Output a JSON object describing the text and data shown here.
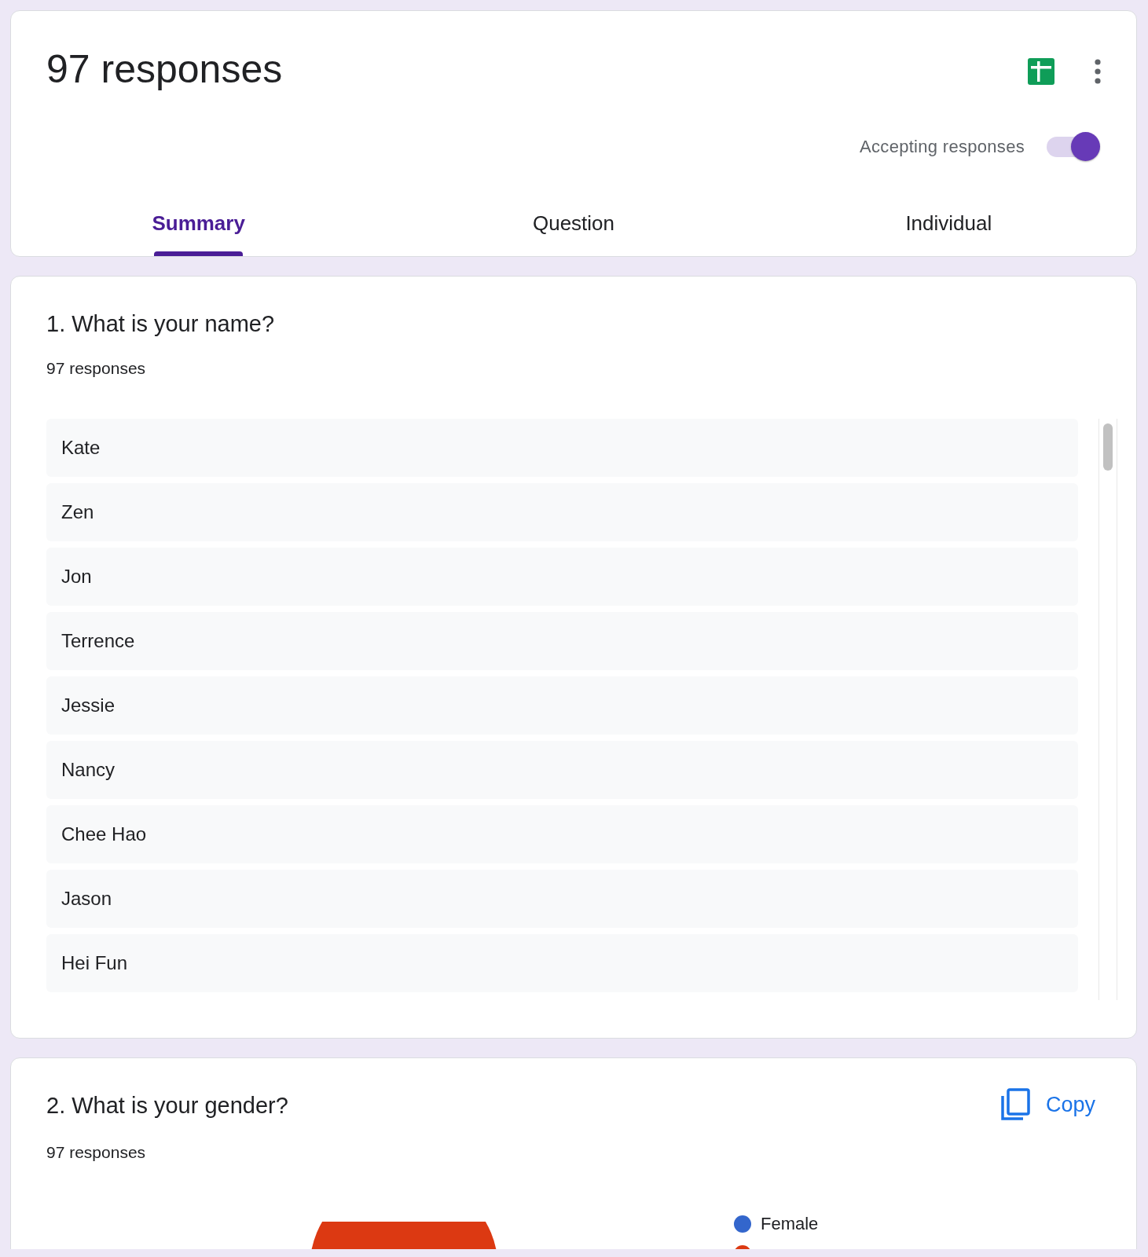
{
  "header": {
    "title": "97 responses",
    "accepting_label": "Accepting responses",
    "accepting_on": true,
    "tabs": [
      {
        "label": "Summary",
        "selected": true
      },
      {
        "label": "Question",
        "selected": false
      },
      {
        "label": "Individual",
        "selected": false
      }
    ]
  },
  "questions": [
    {
      "kind": "list",
      "title": "1. What is your name?",
      "count": "97 responses",
      "answers": [
        "Kate",
        "Zen",
        "Jon",
        "Terrence",
        "Jessie",
        "Nancy",
        "Chee Hao",
        "Jason",
        "Hei Fun"
      ]
    },
    {
      "kind": "pie",
      "title": "2. What is your gender?",
      "count": "97 responses",
      "copy_label": "Copy",
      "legend": [
        {
          "label": "Female",
          "color": "#3366cc"
        },
        {
          "color": "#dc3912"
        }
      ]
    }
  ]
}
